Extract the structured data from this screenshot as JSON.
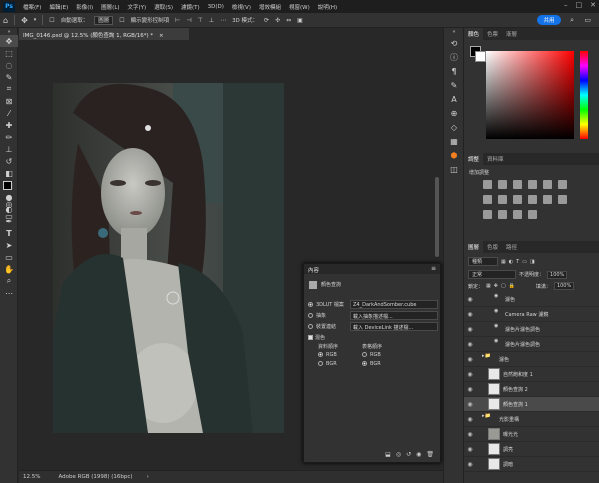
{
  "app": {
    "logo": "Ps"
  },
  "menu": [
    "檔案(F)",
    "編輯(E)",
    "影像(I)",
    "圖層(L)",
    "文字(Y)",
    "選取(S)",
    "濾鏡(T)",
    "3D(D)",
    "檢視(V)",
    "增效模組",
    "視窗(W)",
    "說明(H)"
  ],
  "options": {
    "auto_select_label": "自動選取：",
    "auto_select_value": "圖層",
    "transform_label": "顯示變形控制項",
    "mode_3d": "3D 模式：",
    "share_label": "共用"
  },
  "tab": {
    "title": "IMG_0146.psd @ 12.5% (顏色查詢 1, RGB/16*) *",
    "close": "×"
  },
  "status": {
    "zoom": "12.5%",
    "profile": "Adobe RGB (1998) (16bpc)",
    "arrow": "›"
  },
  "color_panel": {
    "tabs": [
      "顏色",
      "色票",
      "漸層"
    ],
    "active": 0
  },
  "adjust_panel": {
    "tabs": [
      "調整",
      "資料庫"
    ],
    "active": 0,
    "add_label": "增加調整"
  },
  "layers_panel": {
    "tabs": [
      "圖層",
      "色版",
      "路徑"
    ],
    "active": 0,
    "kind_label": "種類",
    "blend_mode": "正常",
    "opacity_label": "不透明度：",
    "opacity": "100%",
    "lock_label": "鎖定：",
    "fill_label": "填滿：",
    "fill": "100%",
    "layers": [
      {
        "name": "濾色",
        "indent": 3,
        "type": "fx"
      },
      {
        "name": "Camera Raw 濾鏡",
        "indent": 3,
        "type": "fx"
      },
      {
        "name": "濾色片濾色調色",
        "indent": 3,
        "type": "fx"
      },
      {
        "name": "濾色片濾色調色",
        "indent": 3,
        "type": "fx"
      },
      {
        "name": "濾色",
        "indent": 1,
        "type": "group"
      },
      {
        "name": "自然飽和度 1",
        "indent": 2,
        "type": "adj"
      },
      {
        "name": "顏色查詢 2",
        "indent": 2,
        "type": "adj"
      },
      {
        "name": "顏色查詢 1",
        "indent": 2,
        "type": "adj",
        "selected": true
      },
      {
        "name": "光影重構",
        "indent": 1,
        "type": "group"
      },
      {
        "name": "曝光光",
        "indent": 2,
        "type": "img"
      },
      {
        "name": "調亮",
        "indent": 2,
        "type": "adj"
      },
      {
        "name": "調暗",
        "indent": 2,
        "type": "adj"
      }
    ]
  },
  "properties": {
    "title": "內容",
    "subtitle": "顏色查詢",
    "lut3d_label": "3DLUT 檔案",
    "lut3d_value": "Z4_DarkAndSomber.cube",
    "abstract_label": "抽象",
    "abstract_value": "載入抽象描述檔...",
    "devicelink_label": "裝置連結",
    "devicelink_value": "載入 DeviceLink 描述檔...",
    "dither_label": "混色",
    "data_order_label": "資料順序",
    "table_order_label": "表格順序",
    "data_order": [
      "RGB",
      "BGR"
    ],
    "table_order": [
      "RGB",
      "BGR"
    ],
    "data_order_selected": "RGB",
    "table_order_selected": "BGR"
  }
}
